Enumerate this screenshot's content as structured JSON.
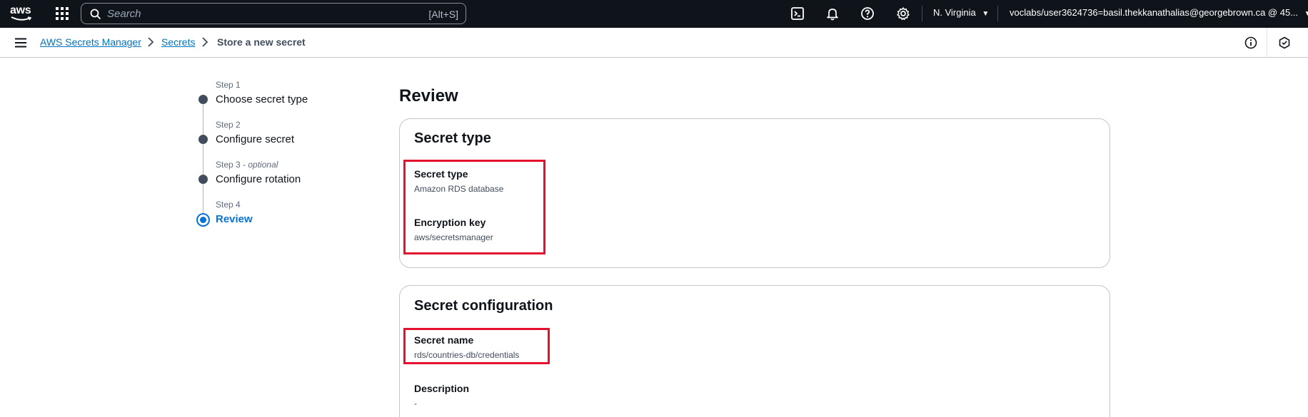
{
  "topnav": {
    "logo_text": "aws",
    "search_placeholder": "Search",
    "search_shortcut": "[Alt+S]",
    "region": "N. Virginia",
    "account": "voclabs/user3624736=basil.thekkanathalias@georgebrown.ca @ 45..."
  },
  "breadcrumb": {
    "service": "AWS Secrets Manager",
    "secrets": "Secrets",
    "current": "Store a new secret"
  },
  "wizard": {
    "steps": [
      {
        "label": "Step 1",
        "optional": "",
        "title": "Choose secret type"
      },
      {
        "label": "Step 2",
        "optional": "",
        "title": "Configure secret"
      },
      {
        "label": "Step 3",
        "optional": "optional",
        "title": "Configure rotation"
      },
      {
        "label": "Step 4",
        "optional": "",
        "title": "Review"
      }
    ],
    "step3_sep": " - "
  },
  "main": {
    "title": "Review",
    "secret_type_card": {
      "title": "Secret type",
      "fields": [
        {
          "label": "Secret type",
          "value": "Amazon RDS database"
        },
        {
          "label": "Encryption key",
          "value": "aws/secretsmanager"
        }
      ]
    },
    "secret_config_card": {
      "title": "Secret configuration",
      "fields": [
        {
          "label": "Secret name",
          "value": "rds/countries-db/credentials"
        },
        {
          "label": "Description",
          "value": "-"
        }
      ]
    }
  },
  "colors": {
    "topbar": "#0f141a",
    "link": "#0073bb",
    "active_step": "#0972d3",
    "highlight": "#e3102f"
  }
}
